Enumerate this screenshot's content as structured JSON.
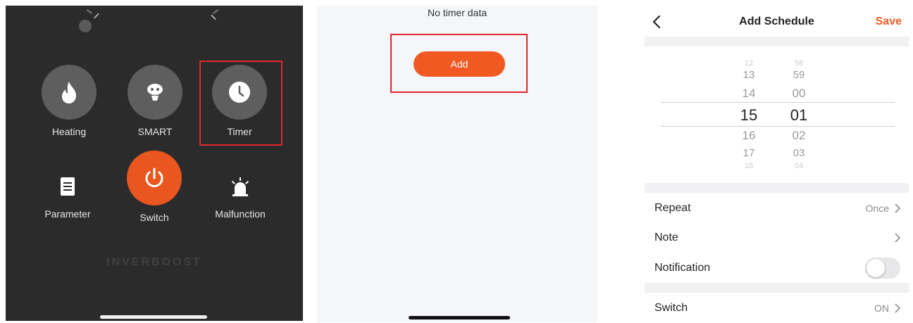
{
  "panel1": {
    "controls": {
      "heating": {
        "label": "Heating",
        "icon": "flame-icon"
      },
      "smart": {
        "label": "SMART",
        "icon": "robot-icon"
      },
      "timer": {
        "label": "Timer",
        "icon": "clock-icon"
      },
      "parameter": {
        "label": "Parameter",
        "icon": "document-icon"
      },
      "switch": {
        "label": "Switch",
        "icon": "power-icon"
      },
      "malfunction": {
        "label": "Malfunction",
        "icon": "alarm-icon"
      }
    },
    "brand": "INVERBOOST",
    "colors": {
      "background": "#2b2b2b",
      "button": "#5e5e5e",
      "switch": "#e9561f",
      "highlight": "#e0282b"
    }
  },
  "panel2": {
    "empty_text": "No timer data",
    "add_label": "Add",
    "colors": {
      "accent": "#f05a22"
    }
  },
  "panel3": {
    "title": "Add Schedule",
    "save_label": "Save",
    "picker": {
      "hours": [
        "12",
        "13",
        "14",
        "15",
        "16",
        "17",
        "18"
      ],
      "minutes": [
        "58",
        "59",
        "00",
        "01",
        "02",
        "03",
        "04"
      ],
      "selected_hour": "15",
      "selected_minute": "01"
    },
    "rows": {
      "repeat": {
        "label": "Repeat",
        "value": "Once"
      },
      "note": {
        "label": "Note"
      },
      "notification": {
        "label": "Notification",
        "enabled": false
      },
      "switch": {
        "label": "Switch",
        "value": "ON"
      }
    },
    "colors": {
      "accent": "#f05a22"
    }
  }
}
